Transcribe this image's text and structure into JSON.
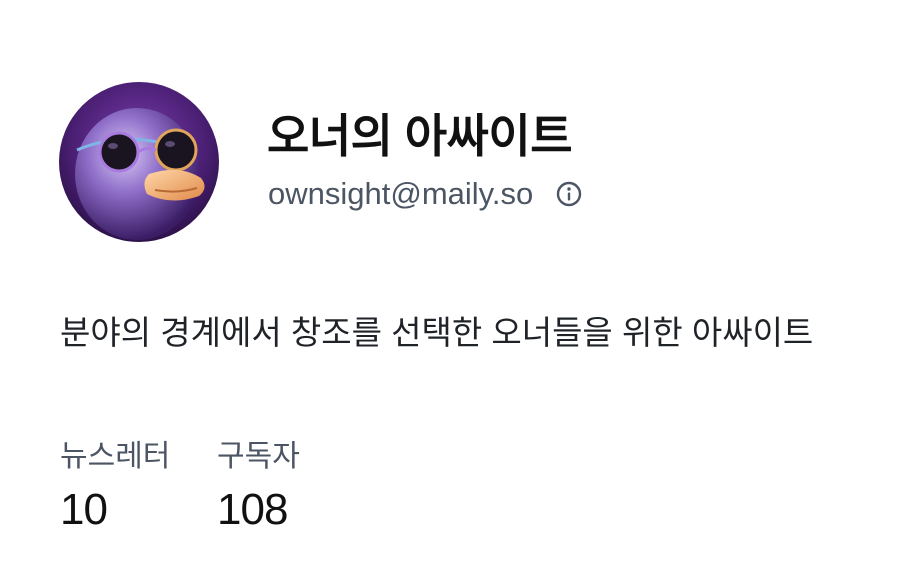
{
  "profile": {
    "name": "오너의 아싸이트",
    "email": "ownsight@maily.so",
    "description": "분야의 경계에서 창조를 선택한 오너들을 위한 아싸이트",
    "avatar_icon": "duck-with-sunglasses-avatar",
    "info_icon": "info-icon"
  },
  "stats": [
    {
      "label": "뉴스레터",
      "value": "10"
    },
    {
      "label": "구독자",
      "value": "108"
    }
  ],
  "colors": {
    "title": "#111111",
    "muted": "#4b5563",
    "background": "#ffffff",
    "avatar_bg": "#4a1f73"
  }
}
